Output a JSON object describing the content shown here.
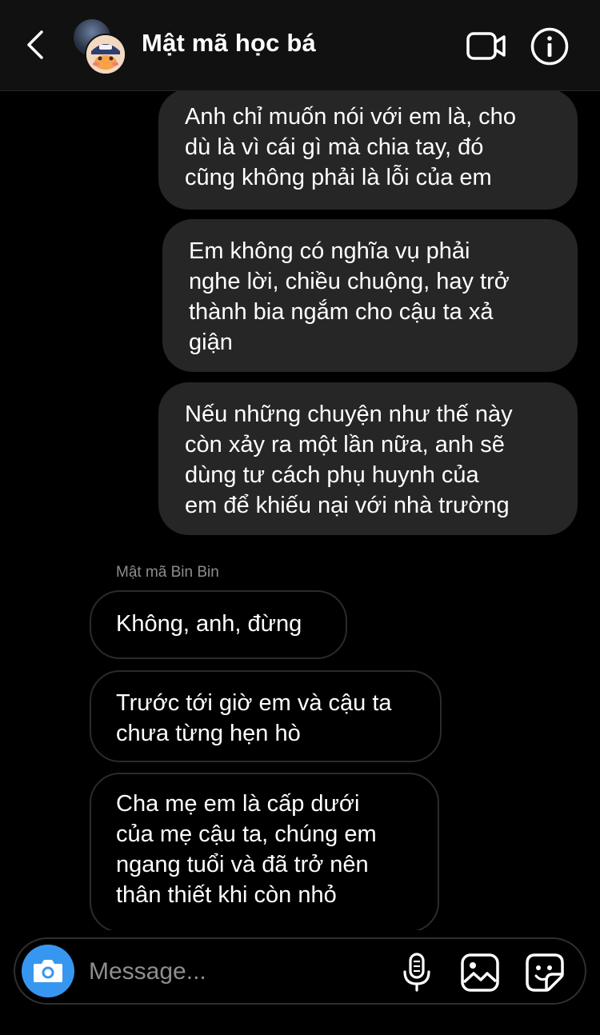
{
  "header": {
    "title": "Mật mã học bá",
    "icons": [
      "back-arrow-icon",
      "video-call-icon",
      "info-icon"
    ]
  },
  "messages": {
    "outgoing": [
      {
        "text": "Anh chỉ muốn nói với em là, cho\ndù là vì cái gì mà chia tay, đó\ncũng không phải là lỗi của em"
      },
      {
        "text": "Em không có nghĩa vụ phải\nnghe lời, chiều chuộng, hay trở\nthành bia ngắm cho cậu ta xả\ngiận"
      },
      {
        "text": "Nếu những chuyện như thế này\ncòn xảy ra một lần nữa, anh sẽ\ndùng tư cách phụ huynh của\nem để khiếu nại với nhà trường"
      }
    ],
    "sender_name": "Mật mã Bin Bin",
    "incoming": [
      {
        "text": "Không, anh, đừng"
      },
      {
        "text": "Trước tới giờ em và cậu ta\nchưa từng hẹn hò"
      },
      {
        "text": "Cha mẹ em là cấp dưới\ncủa mẹ cậu ta, chúng em\nngang tuổi và đã trở nên\nthân thiết khi còn nhỏ"
      }
    ]
  },
  "composer": {
    "placeholder": "Message...",
    "value": "",
    "icons": [
      "camera-icon",
      "microphone-icon",
      "gallery-icon",
      "sticker-icon"
    ],
    "camera_color": "#3797f0"
  },
  "colors": {
    "background": "#000000",
    "outgoing_bubble": "#262626",
    "incoming_border": "#2b2b2b"
  }
}
